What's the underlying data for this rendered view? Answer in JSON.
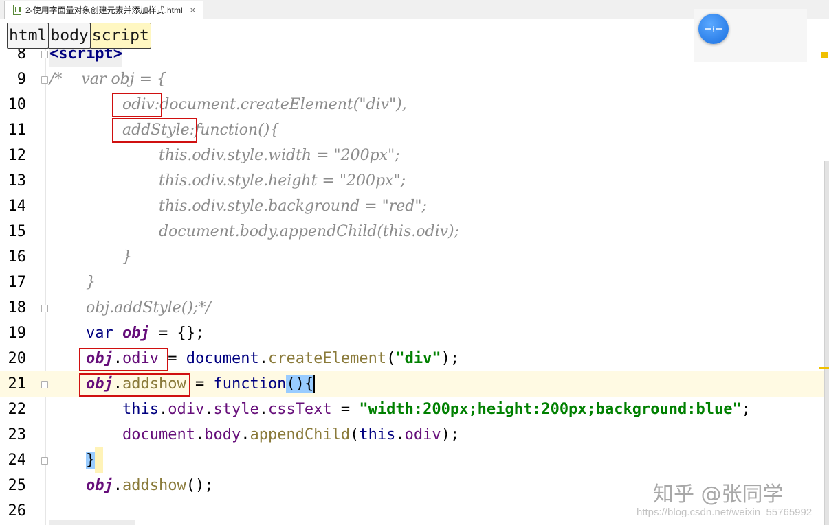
{
  "tab": {
    "title": "2-使用字面量对象创建元素并添加样式.html",
    "close": "×"
  },
  "breadcrumb": [
    "html",
    "body",
    "script"
  ],
  "lines": {
    "l8": {
      "n": "8",
      "t1": "<script>"
    },
    "l9": {
      "n": "9",
      "t1": "/*    var obj = {"
    },
    "l10": {
      "n": "10",
      "t1": "odiv",
      "t2": ":document.createElement(\"div\"),"
    },
    "l11": {
      "n": "11",
      "t1": "addStyle",
      "t2": ":function(){"
    },
    "l12": {
      "n": "12",
      "t1": "this.odiv.style.width = \"200px\";"
    },
    "l13": {
      "n": "13",
      "t1": "this.odiv.style.height = \"200px\";"
    },
    "l14": {
      "n": "14",
      "t1": "this.odiv.style.background = \"red\";"
    },
    "l15": {
      "n": "15",
      "t1": "document.body.appendChild(this.odiv);"
    },
    "l16": {
      "n": "16",
      "t1": "}"
    },
    "l17": {
      "n": "17",
      "t1": "}"
    },
    "l18": {
      "n": "18",
      "t1": "obj.addStyle();*/"
    },
    "l19": {
      "n": "19",
      "kw": "var ",
      "v": "obj",
      "p": " = {};"
    },
    "l20": {
      "n": "20",
      "v": "obj",
      "p1": ".",
      "prop": "odiv",
      "p2": " = ",
      "obj2": "document",
      "p3": ".",
      "m": "createElement",
      "p4": "(",
      "s": "\"div\"",
      "p5": ");"
    },
    "l21": {
      "n": "21",
      "v": "obj",
      "p1": ".",
      "m": "addshow",
      "p2": " = ",
      "kw": "function",
      "b1": "()",
      "b2": "{"
    },
    "l22": {
      "n": "22",
      "kw": "this",
      "p1": ".",
      "prop": "odiv",
      "p2": ".",
      "prop2": "style",
      "p3": ".",
      "prop3": "cssText",
      "p4": " = ",
      "s": "\"width:200px;height:200px;background:blue\"",
      "p5": ";"
    },
    "l23": {
      "n": "23",
      "obj": "document",
      "p1": ".",
      "prop": "body",
      "p2": ".",
      "m": "appendChild",
      "p3": "(",
      "kw": "this",
      "p4": ".",
      "prop2": "odiv",
      "p5": ");"
    },
    "l24": {
      "n": "24",
      "t1": "}"
    },
    "l25": {
      "n": "25",
      "v": "obj",
      "p1": ".",
      "m": "addshow",
      "p2": "();"
    },
    "l26": {
      "n": "26"
    }
  },
  "watermark": {
    "text": "知乎 @张同学",
    "url": "https://blog.csdn.net/weixin_55765992"
  },
  "colors": {
    "comment": "#8c8c8c",
    "keyword": "#000080",
    "variable": "#660e7a",
    "method": "#8a7a3a",
    "string": "#008000",
    "highlight_box": "#d01010",
    "current_line": "#fffae3"
  }
}
